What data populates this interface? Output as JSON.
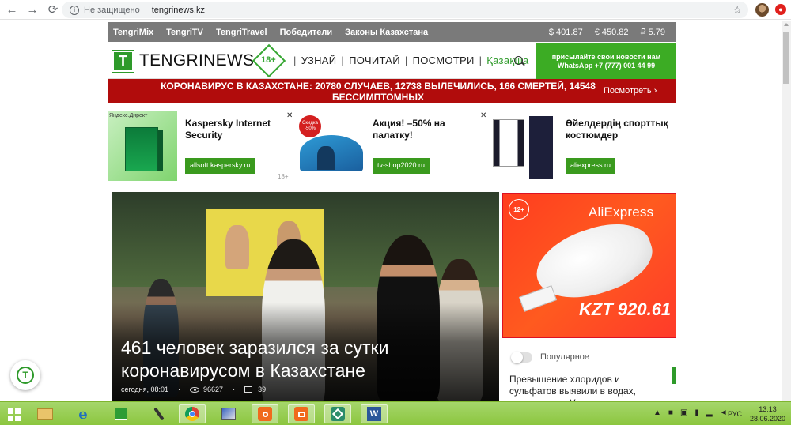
{
  "browser": {
    "security": "Не защищено",
    "url": "tengrinews.kz"
  },
  "topnav": {
    "links": [
      "TengriMix",
      "TengriTV",
      "TengriTravel",
      "Победители",
      "Законы Казахстана"
    ],
    "rates": [
      "$ 401.87",
      "€ 450.82",
      "₽ 5.79"
    ]
  },
  "header": {
    "logo": "TENGRINEWS",
    "age": "18+",
    "nav": [
      "УЗНАЙ",
      "ПОЧИТАЙ",
      "ПОСМОТРИ"
    ],
    "lang": "Қазақша",
    "whatsapp_line1": "присылайте свои новости нам",
    "whatsapp_line2": "WhatsApp +7 (777) 001 44 99"
  },
  "alert": {
    "text": "КОРОНАВИРУС В КАЗАХСТАНЕ: 20780 СЛУЧАЕВ, 12738 ВЫЛЕЧИЛИСЬ, 166 СМЕРТЕЙ, 14548 БЕССИМПТОМНЫХ",
    "link": "Посмотреть"
  },
  "ads": {
    "yandex": "Яндекс.Директ",
    "age": "18+",
    "items": [
      {
        "title": "Kaspersky Internet Security",
        "button": "allsoft.kaspersky.ru"
      },
      {
        "title": "Акция! –50% на палатку!",
        "button": "tv-shop2020.ru",
        "badge": "Скидка -50%"
      },
      {
        "title": "Әйелдердің спорттық костюмдер",
        "button": "aliexpress.ru"
      }
    ]
  },
  "article": {
    "headline": "461 человек заразился за сутки коронавирусом в Казахстане",
    "date": "сегодня, 08:01",
    "views": "96627",
    "comments": "39"
  },
  "aliad": {
    "age": "12+",
    "logo": "AliExpress",
    "price": "KZT 920.61"
  },
  "popular": {
    "label": "Популярное",
    "item": "Превышение хлоридов и сульфатов выявили в водах, спущенных в Урал"
  },
  "taskbar": {
    "lang": "РУС",
    "time": "13:13",
    "date": "28.06.2020"
  }
}
